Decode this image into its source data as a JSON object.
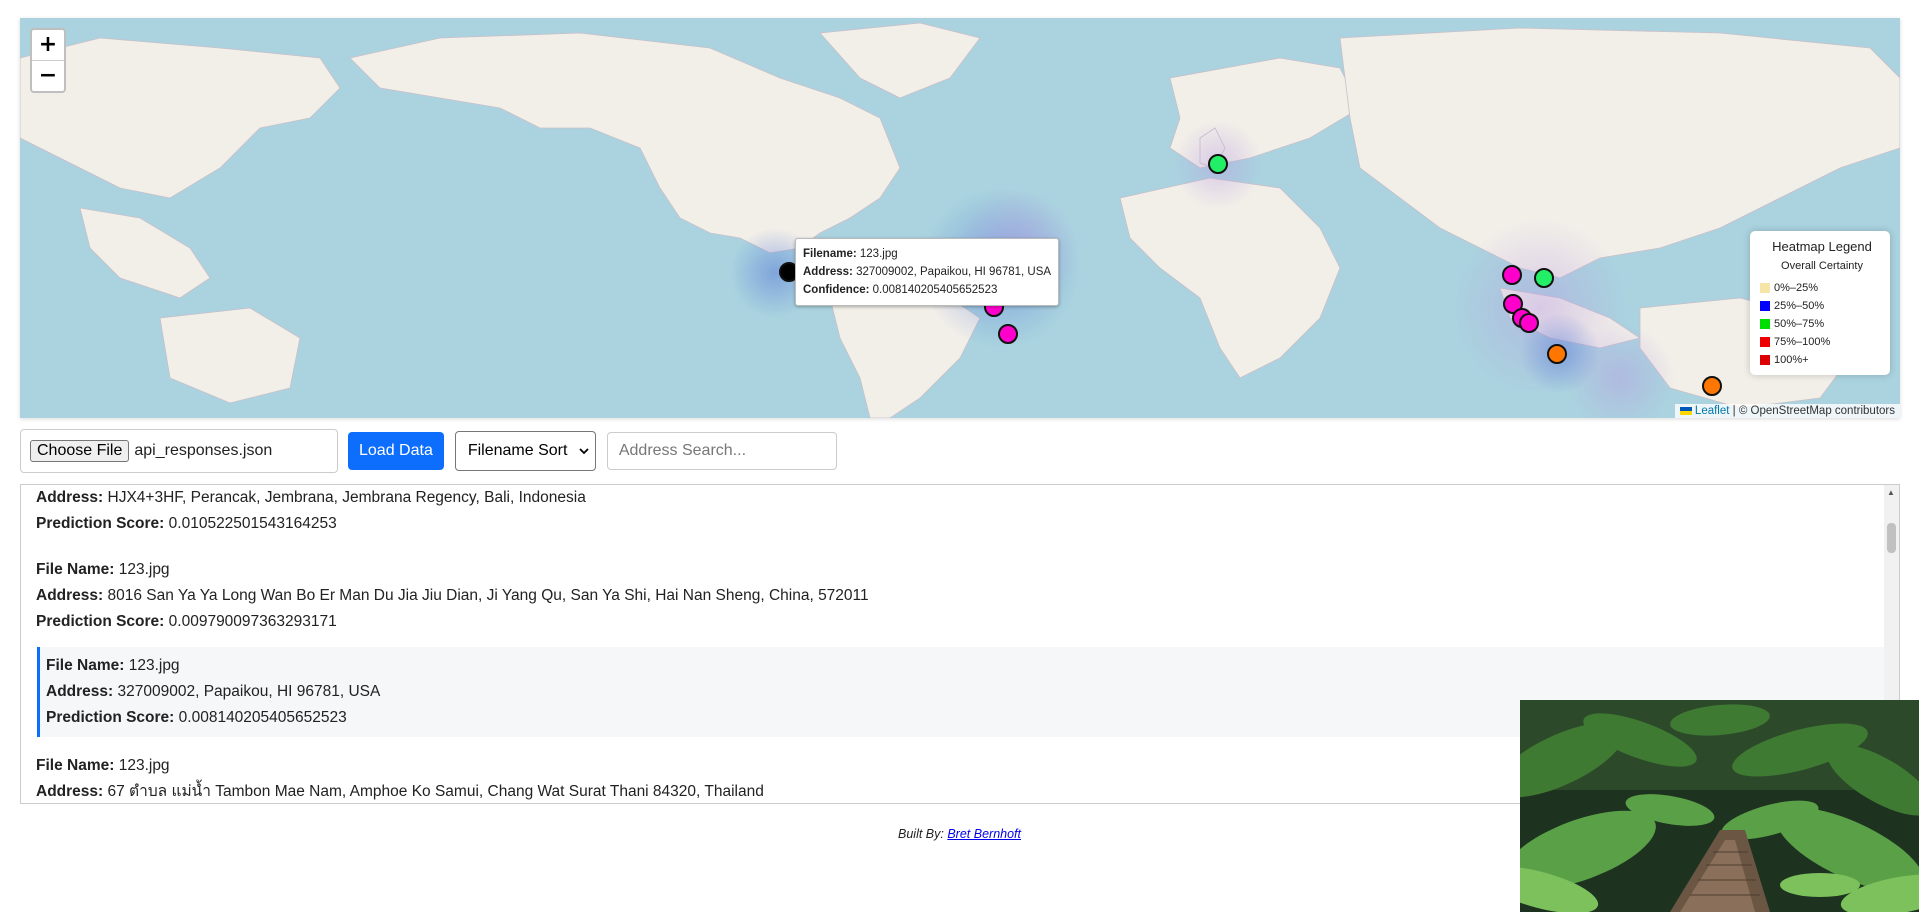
{
  "map": {
    "zoom_in": "+",
    "zoom_out": "−",
    "popup": {
      "filename_label": "Filename:",
      "filename": "123.jpg",
      "address_label": "Address:",
      "address": "327009002, Papaikou, HI 96781, USA",
      "confidence_label": "Confidence:",
      "confidence": "0.008140205405652523"
    },
    "legend": {
      "title": "Heatmap Legend",
      "subtitle": "Overall Certainty",
      "items": [
        {
          "label": "0%–25%",
          "color": "#f5e6a8"
        },
        {
          "label": "25%–50%",
          "color": "#0000ff"
        },
        {
          "label": "50%–75%",
          "color": "#00dd00"
        },
        {
          "label": "75%–100%",
          "color": "#ee0000"
        },
        {
          "label": "100%+",
          "color": "#dd0000"
        }
      ]
    },
    "attribution": {
      "leaflet": "Leaflet",
      "separator": "|",
      "osm": "© OpenStreetMap contributors"
    },
    "marker_colors": {
      "magenta": "#ff00cc",
      "green": "#22ee66",
      "orange": "#ff7700",
      "black": "#000000"
    }
  },
  "toolbar": {
    "file_button": "Choose File",
    "file_name": "api_responses.json",
    "load_button": "Load Data",
    "sort_selected": "Filename Sort",
    "search_placeholder": "Address Search..."
  },
  "labels": {
    "file_name": "File Name:",
    "address": "Address:",
    "score": "Prediction Score:"
  },
  "results": [
    {
      "address": "HJX4+3HF, Perancak, Jembrana, Jembrana Regency, Bali, Indonesia",
      "score": "0.010522501543164253"
    },
    {
      "file": "123.jpg",
      "address": "8016 San Ya Ya Long Wan Bo Er Man Du Jia Jiu Dian, Ji Yang Qu, San Ya Shi, Hai Nan Sheng, China, 572011",
      "score": "0.009790097363293171"
    },
    {
      "file": "123.jpg",
      "address": "327009002, Papaikou, HI 96781, USA",
      "score": "0.008140205405652523"
    },
    {
      "file": "123.jpg",
      "address": "67 ตำบล แม่น้ำ Tambon Mae Nam, Amphoe Ko Samui, Chang Wat Surat Thani 84320, Thailand"
    }
  ],
  "footer": {
    "built_by": "Built By:",
    "author": "Bret Bernhoft"
  }
}
